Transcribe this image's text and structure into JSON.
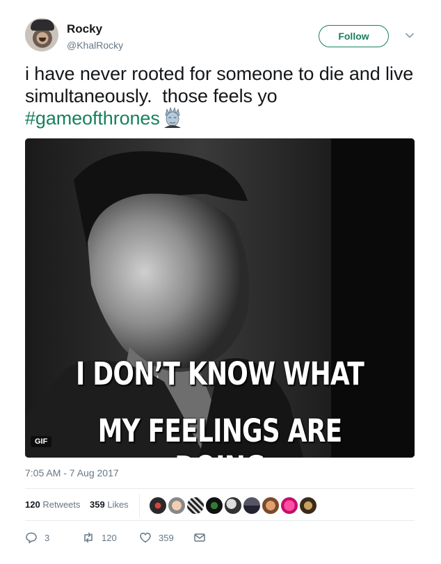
{
  "user": {
    "name": "Rocky",
    "handle": "@KhalRocky"
  },
  "follow_label": "Follow",
  "tweet": {
    "text": "i have never rooted for someone to die and live simultaneously.  those feels yo ",
    "hashtag": "#gameofthrones",
    "emoji_icon": "night-king-emoji-icon"
  },
  "media": {
    "caption_line1": "I DON’T KNOW WHAT",
    "caption_line2": "MY FEELINGS ARE DOING",
    "badge": "GIF"
  },
  "timestamp": "7:05 AM - 7 Aug 2017",
  "stats": {
    "retweets_count": "120",
    "retweets_label": "Retweets",
    "likes_count": "359",
    "likes_label": "Likes",
    "liker_avatar_count": 9
  },
  "actions": {
    "reply_count": "3",
    "retweet_count": "120",
    "like_count": "359"
  },
  "colors": {
    "accent": "#17805d",
    "secondary_text": "#657786",
    "divider": "#e6ecf0"
  }
}
